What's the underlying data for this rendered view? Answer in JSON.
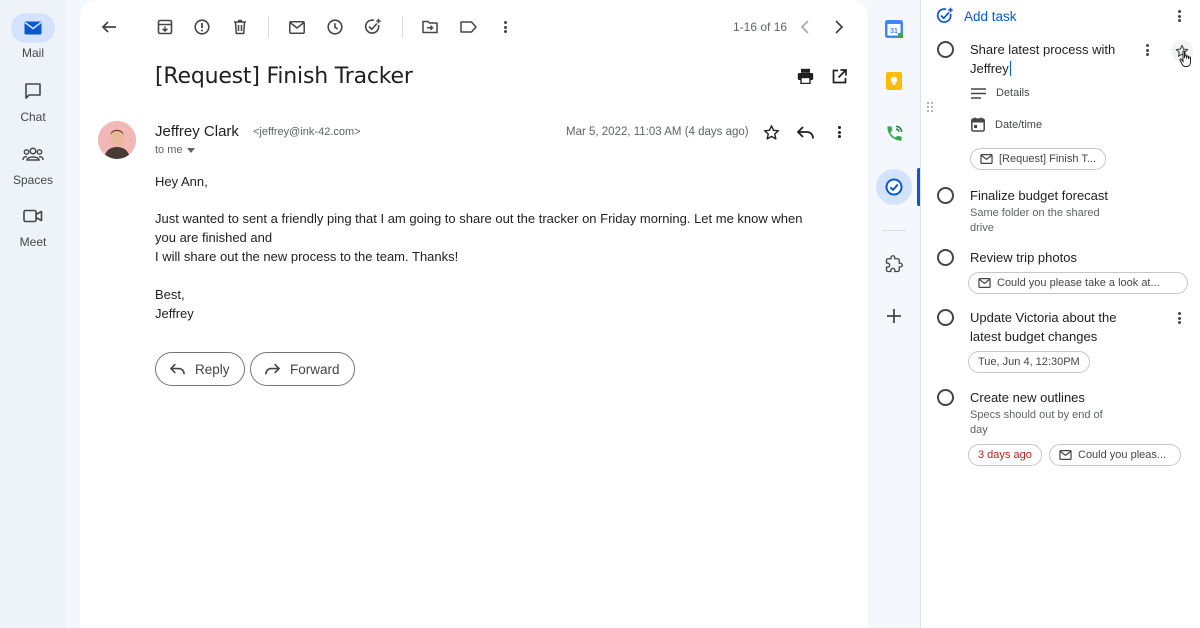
{
  "nav": {
    "items": [
      {
        "label": "Mail",
        "icon": "mail-icon"
      },
      {
        "label": "Chat",
        "icon": "chat-icon"
      },
      {
        "label": "Spaces",
        "icon": "spaces-icon"
      },
      {
        "label": "Meet",
        "icon": "meet-icon"
      }
    ]
  },
  "toolbar": {
    "pager": "1-16 of 16",
    "icons": [
      "back-icon",
      "archive-icon",
      "report-spam-icon",
      "delete-icon",
      "mark-unread-icon",
      "snooze-icon",
      "add-task-icon",
      "move-to-icon",
      "label-icon",
      "more-icon",
      "prev-icon",
      "next-icon"
    ]
  },
  "email": {
    "subject": "[Request] Finish Tracker",
    "sender_name": "Jeffrey Clark",
    "sender_email": "<jeffrey@ink-42.com>",
    "recipient": "to me",
    "date": "Mar 5, 2022, 11:03 AM (4 days ago)",
    "body": [
      "Hey Ann,",
      "Just wanted to sent a friendly ping that I am going to share out the tracker on Friday morning. Let me know when",
      "you are finished and",
      "I will share out the new process to the team. Thanks!",
      "Best,",
      "Jeffrey"
    ],
    "reply_label": "Reply",
    "forward_label": "Forward"
  },
  "tasks": {
    "add_task_label": "Add task",
    "editing": {
      "title_line1": "Share latest process with",
      "title_line2": "Jeffrey",
      "details_label": "Details",
      "datetime_label": "Date/time",
      "chip": "[Request] Finish T..."
    },
    "items": [
      {
        "title": "Finalize budget forecast",
        "desc1": "Same folder on the shared",
        "desc2": "drive"
      },
      {
        "title": "Review trip photos",
        "chip": "Could you please take a look at..."
      },
      {
        "title1": "Update Victoria about the",
        "title2": "latest budget changes",
        "chip": "Tue, Jun 4, 12:30PM"
      },
      {
        "title": "Create new outlines",
        "desc1": "Specs should out by end of",
        "desc2": "day",
        "chip_due": "3 days ago",
        "chip": "Could you pleas..."
      }
    ]
  },
  "colors": {
    "accent": "#0b57d0",
    "active_bg": "#d3e3fd",
    "overdue": "#b3261e"
  }
}
